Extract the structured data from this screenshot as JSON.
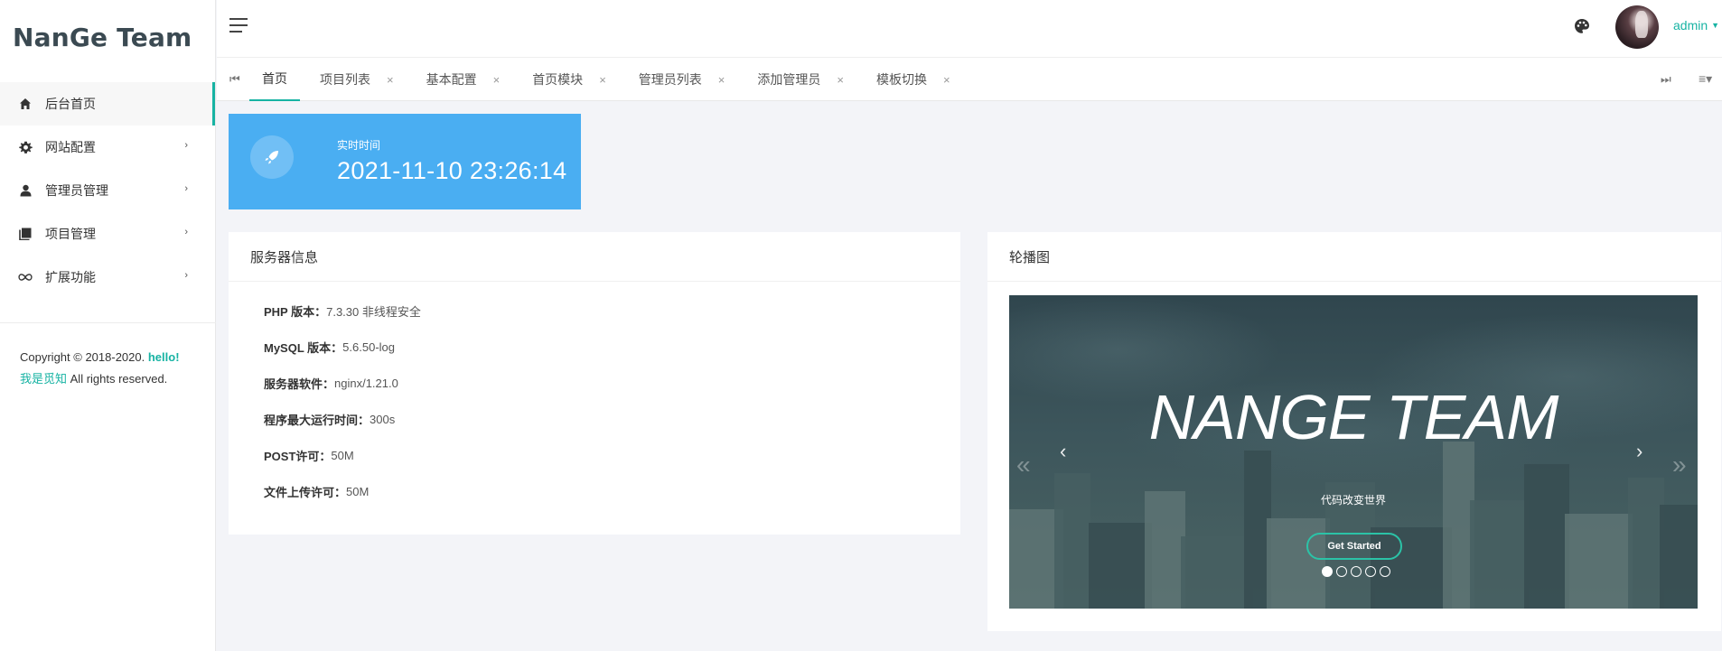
{
  "brand": "NanGe Team",
  "sidebar": {
    "items": [
      {
        "label": "后台首页",
        "icon": "home-icon"
      },
      {
        "label": "网站配置",
        "icon": "gear-icon"
      },
      {
        "label": "管理员管理",
        "icon": "user-icon"
      },
      {
        "label": "项目管理",
        "icon": "book-icon"
      },
      {
        "label": "扩展功能",
        "icon": "infinity-icon"
      }
    ],
    "copyright": {
      "prefix": "Copyright © 2018-2020.",
      "hello": "hello!",
      "author": "我是觅知",
      "suffix": "All rights reserved."
    }
  },
  "header": {
    "user": "admin"
  },
  "tabs": [
    {
      "label": "首页",
      "closable": false
    },
    {
      "label": "项目列表",
      "closable": true
    },
    {
      "label": "基本配置",
      "closable": true
    },
    {
      "label": "首页模块",
      "closable": true
    },
    {
      "label": "管理员列表",
      "closable": true
    },
    {
      "label": "添加管理员",
      "closable": true
    },
    {
      "label": "模板切换",
      "closable": true
    }
  ],
  "time_card": {
    "label": "实时时间",
    "value": "2021-11-10 23:26:14"
  },
  "server_panel": {
    "title": "服务器信息",
    "rows": [
      {
        "key": "PHP 版本：",
        "value": "7.3.30 非线程安全"
      },
      {
        "key": "MySQL 版本：",
        "value": "5.6.50-log"
      },
      {
        "key": "服务器软件：",
        "value": "nginx/1.21.0"
      },
      {
        "key": "程序最大运行时间：",
        "value": "300s"
      },
      {
        "key": "POST许可：",
        "value": "50M"
      },
      {
        "key": "文件上传许可：",
        "value": "50M"
      }
    ]
  },
  "carousel_panel": {
    "title": "轮播图",
    "slide_title": "NANGE TEAM",
    "slide_subtitle": "代码改变世界",
    "button": "Get Started",
    "slide_count": 5,
    "active_slide": 1
  },
  "colors": {
    "accent": "#17b3a3",
    "time_card_bg": "#4aaef2"
  }
}
